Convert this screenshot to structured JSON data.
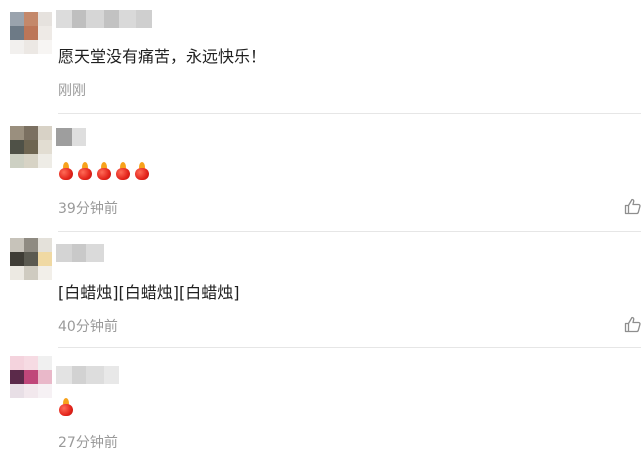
{
  "comments": [
    {
      "avatar_colors": [
        "#9aa3ad",
        "#c4886a",
        "#e6e2de",
        "#6d7a86",
        "#bc7658",
        "#eeeae6",
        "#f2f0ee",
        "#ece8e4",
        "#f7f5f3"
      ],
      "username_colors": [
        "#dcdcdc",
        "#bfbfbf",
        "#d6d6d6",
        "#c2c2c2",
        "#d9d9d9",
        "#cfcfcf"
      ],
      "text": "愿天堂没有痛苦，永远快乐！",
      "time": "刚刚",
      "has_like": false
    },
    {
      "avatar_colors": [
        "#9a8f7e",
        "#7b7061",
        "#d8d2c6",
        "#4f5147",
        "#6e6551",
        "#e2ddd2",
        "#cdd0c3",
        "#d7d3c5",
        "#eeece6"
      ],
      "username_colors": [
        "#9e9e9e",
        "#dedede"
      ],
      "candle_count": 5,
      "time": "39分钟前",
      "has_like": true
    },
    {
      "avatar_colors": [
        "#c7c3ba",
        "#8f8b82",
        "#e4e1da",
        "#3f3d36",
        "#5b5a51",
        "#f0d9a3",
        "#ece9e2",
        "#cfcbc0",
        "#f2efe9"
      ],
      "username_colors": [
        "#d4d4d4",
        "#c9c9c9",
        "#dadada"
      ],
      "text": "[白蜡烛][白蜡烛][白蜡烛]",
      "time": "40分钟前",
      "has_like": true
    },
    {
      "avatar_colors": [
        "#f4d3dd",
        "#f6dbe3",
        "#f0f0f0",
        "#5b2a4a",
        "#c0477a",
        "#e9b8c9",
        "#e8dfe6",
        "#f2e8ed",
        "#f6f1f4"
      ],
      "username_colors": [
        "#e3e3e3",
        "#d2d2d2",
        "#dddddd",
        "#e8e8e8"
      ],
      "candle_count": 1,
      "time": "27分钟前",
      "has_like": false
    }
  ],
  "icons": {
    "candle": "red-candle-emoji-icon",
    "like": "thumbs-up-outline-icon"
  },
  "colors": {
    "text": "#1f1f1f",
    "muted": "#9a9a9a",
    "divider": "#e6e6e6",
    "candle_red": "#e3241b",
    "candle_flame": "#f7a21b"
  }
}
